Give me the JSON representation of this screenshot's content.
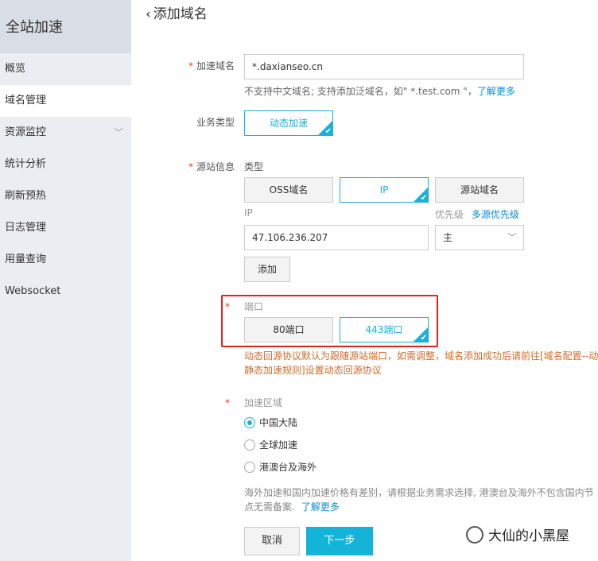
{
  "sidebar": {
    "title": "全站加速",
    "items": [
      {
        "label": "概览"
      },
      {
        "label": "域名管理"
      },
      {
        "label": "资源监控"
      },
      {
        "label": "统计分析"
      },
      {
        "label": "刷新预热"
      },
      {
        "label": "日志管理"
      },
      {
        "label": "用量查询"
      },
      {
        "label": "Websocket"
      }
    ]
  },
  "page": {
    "back_icon": "‹",
    "title": "添加域名"
  },
  "domain": {
    "required_mark": "*",
    "label": "加速域名",
    "value": "*.daxianseo.cn",
    "hint": "不支持中文域名; 支持添加泛域名，如\" *.test.com \"，",
    "hint_link": "了解更多"
  },
  "business": {
    "label": "业务类型",
    "option": "动态加速"
  },
  "origin": {
    "required_mark": "*",
    "label": "源站信息",
    "type_label": "类型",
    "types": [
      "OSS域名",
      "IP",
      "源站域名"
    ],
    "selected_type": "IP",
    "ip_label": "IP",
    "ip_value": "47.106.236.207",
    "priority_label": "优先级",
    "priority_link": "多源优先级",
    "priority_value": "主",
    "add_button": "添加"
  },
  "port": {
    "required_mark": "*",
    "label": "端口",
    "options": [
      "80端口",
      "443端口"
    ],
    "selected": "443端口",
    "warning_line1": "动态回源协议默认为跟随源站端口，如需调整，域名添加成功后请前往[域名配置--动",
    "warning_line2": "静态加速规则]设置动态回源协议"
  },
  "region": {
    "required_mark": "*",
    "label": "加速区域",
    "options": [
      "中国大陆",
      "全球加速",
      "港澳台及海外"
    ],
    "selected": "中国大陆",
    "note_line1": "海外加速和国内加速价格有差别，请根据业务需求选择, 港澳台及海外不包含国内节",
    "note_line2": "点无需备案.",
    "note_link": "了解更多"
  },
  "actions": {
    "cancel": "取消",
    "next": "下一步"
  },
  "watermark": {
    "text": "大仙的小黑屋"
  },
  "colors": {
    "accent": "#14b4d9",
    "highlight_box": "#d9251d",
    "warning_text": "#d06b2b",
    "required": "#e0451f"
  }
}
